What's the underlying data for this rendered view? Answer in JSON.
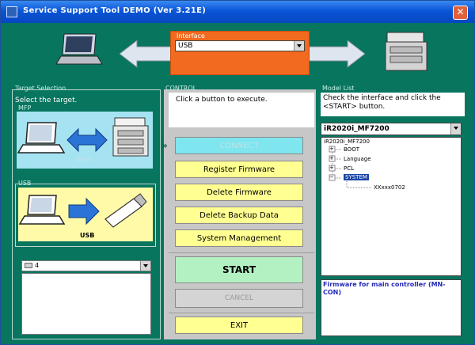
{
  "window": {
    "title": "Service Support Tool DEMO (Ver 3.21E)",
    "close_label": "✕"
  },
  "interface": {
    "label": "Interface",
    "selected": "USB"
  },
  "target": {
    "group_label": "Target Selection",
    "instruction": "Select the target.",
    "mfp_group_label": "MFP",
    "mfp_caption": "MFP",
    "usb_group_label": "USB",
    "usb_caption": "USB",
    "device_select_value": "4"
  },
  "control": {
    "group_label": "CONTROL",
    "instruction": "Click a button to execute.",
    "connect_label": "CONNECT",
    "register_label": "Register Firmware",
    "delete_label": "Delete Firmware",
    "backup_label": "Delete Backup Data",
    "system_label": "System Management",
    "start_label": "START",
    "cancel_label": "CANCEL",
    "exit_label": "EXIT"
  },
  "model": {
    "group_label": "Model List",
    "instruction": "Check the interface and click the <START> button.",
    "selected_model": "iR2020i_MF7200",
    "tree": {
      "root": "iR2020i_MF7200",
      "items": [
        "BOOT",
        "Language",
        "PCL",
        "SYSTEM"
      ],
      "leaf": "XXxxx0702"
    },
    "firmware_note": "Firmware for main controller (MN-CON)"
  },
  "colors": {
    "background": "#08755f",
    "interface_box": "#f26a1f",
    "button_yellow": "#ffff92",
    "connect": "#7fe5ee",
    "start": "#b3f1c3"
  }
}
